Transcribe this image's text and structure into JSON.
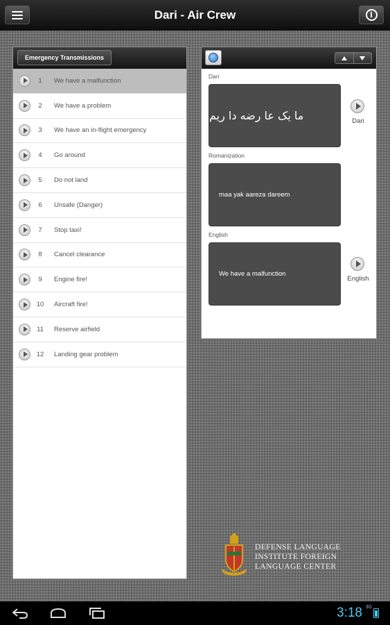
{
  "app": {
    "title": "Dari - Air Crew"
  },
  "list": {
    "section_tab": "Emergency Transmissions",
    "selected_index": 0,
    "items": [
      {
        "num": "1",
        "label": "We have a malfunction"
      },
      {
        "num": "2",
        "label": "We have a problem"
      },
      {
        "num": "3",
        "label": "We have an in-flight emergency"
      },
      {
        "num": "4",
        "label": "Go around"
      },
      {
        "num": "5",
        "label": "Do not land"
      },
      {
        "num": "6",
        "label": "Unsafe (Danger)"
      },
      {
        "num": "7",
        "label": "Stop taxi!"
      },
      {
        "num": "8",
        "label": "Cancel clearance"
      },
      {
        "num": "9",
        "label": "Engine fire!"
      },
      {
        "num": "10",
        "label": "Aircraft fire!"
      },
      {
        "num": "11",
        "label": "Reserve airfield"
      },
      {
        "num": "12",
        "label": "Landing gear problem"
      }
    ]
  },
  "detail": {
    "dari_label": "Dari",
    "dari_text": "ما یک عا رضه دا ریم",
    "dari_play_label": "Dari",
    "romanization_label": "Romanization",
    "romanization_text": "maa yak aareza  dareem",
    "english_label": "English",
    "english_text": "We have a malfunction",
    "english_play_label": "English"
  },
  "logo": {
    "line1": "Defense Language",
    "line2": "Institute Foreign",
    "line3": "Language Center"
  },
  "status": {
    "time": "3:18",
    "signal": "3G"
  },
  "colors": {
    "clock": "#4fc7ee",
    "selected_row": "#bdbdbd",
    "text_box": "#4b4b4b"
  }
}
